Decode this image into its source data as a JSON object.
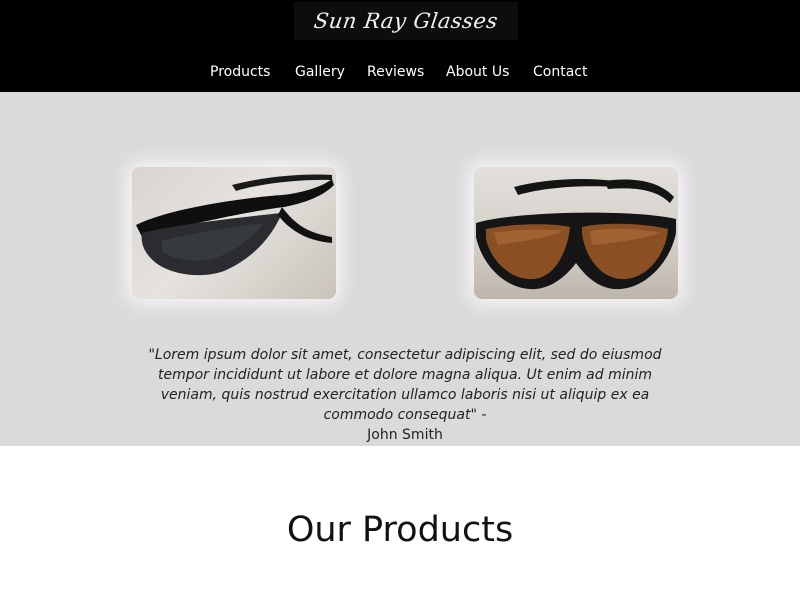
{
  "header": {
    "logo_text": "Sun Ray Glasses",
    "nav": [
      "Products",
      "Gallery",
      "Reviews",
      "About Us",
      "Contact"
    ]
  },
  "showcase": {
    "quote_text": "\"Lorem ipsum dolor sit amet, consectetur adipiscing elit, sed do eiusmod tempor incididunt ut labore et dolore magna aliqua. Ut enim ad minim veniam, quis nostrud exercitation ullamco laboris nisi ut aliquip ex ea commodo consequat\" -",
    "quote_author": "John Smith"
  },
  "products": {
    "title": "Our Products"
  },
  "colors": {
    "header_bg": "#000000",
    "showcase_bg": "#dbd9db",
    "lens_dark": "#2a2c30",
    "lens_brown": "#8a4f22"
  }
}
